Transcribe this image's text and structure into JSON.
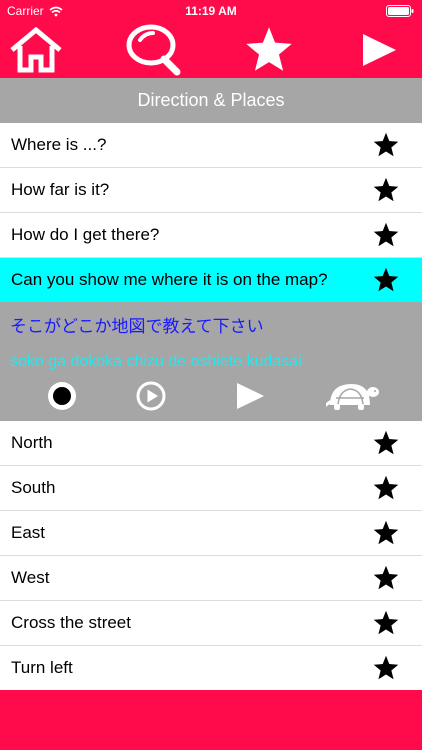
{
  "status_bar": {
    "carrier": "Carrier",
    "time": "11:19 AM"
  },
  "toolbar": {
    "home_icon": "home-icon",
    "search_icon": "search-icon",
    "favorites_icon": "star-icon",
    "play_icon": "play-icon"
  },
  "section": {
    "title": "Direction & Places"
  },
  "phrases_top": [
    {
      "text": "Where is ...?"
    },
    {
      "text": "How far is it?"
    },
    {
      "text": "How do I get there?"
    },
    {
      "text": "Can you show me where it is on the map?"
    }
  ],
  "selected_phrase": {
    "japanese": "そこがどこか地図で教えて下さい",
    "romaji": "soko ga dokoka chizu de oshiete kudasai"
  },
  "player_controls": [
    "record-icon",
    "play-recording-icon",
    "play-icon",
    "slow-turtle-icon"
  ],
  "phrases_bottom": [
    {
      "text": "North"
    },
    {
      "text": "South"
    },
    {
      "text": "East"
    },
    {
      "text": "West"
    },
    {
      "text": "Cross the street"
    },
    {
      "text": "Turn left"
    }
  ],
  "colors": {
    "brand": "#ff0a4a",
    "header_gray": "#a6a6a6",
    "selected_row": "#00ffff",
    "japanese_text": "#1a1aff",
    "romaji_text": "#22e8f0"
  }
}
